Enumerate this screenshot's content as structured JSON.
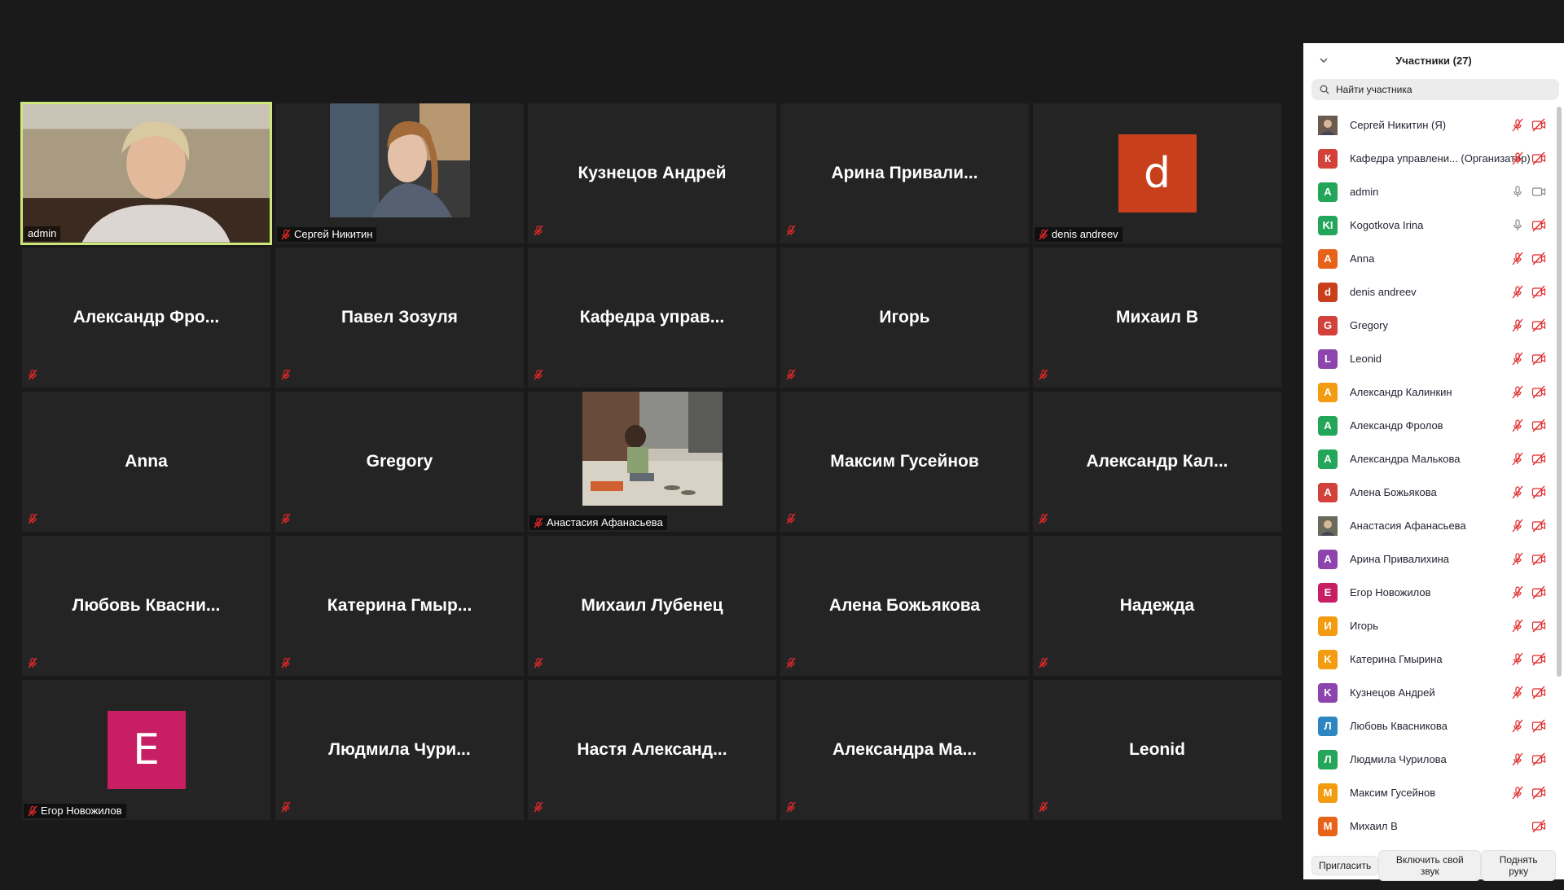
{
  "panel": {
    "title": "Участники (27)",
    "search_placeholder": "Найти участника",
    "footer": {
      "invite": "Пригласить",
      "unmute": "Включить свой звук",
      "raise_hand": "Поднять руку"
    },
    "participants": [
      {
        "name": "Сергей Никитин (Я)",
        "avatar": "",
        "color": "#6b5a4e",
        "photo": true,
        "mic": "muted",
        "video": "off"
      },
      {
        "name": "Кафедра управлени... (Организатор)",
        "avatar": "К",
        "color": "#d2413a",
        "mic": "muted",
        "video": "off"
      },
      {
        "name": "admin",
        "avatar": "A",
        "color": "#23a55a",
        "mic": "on",
        "video": "on"
      },
      {
        "name": "Kogotkova Irina",
        "avatar": "KI",
        "color": "#23a55a",
        "mic": "on",
        "video": "off"
      },
      {
        "name": "Anna",
        "avatar": "A",
        "color": "#e8631a",
        "mic": "muted",
        "video": "off"
      },
      {
        "name": "denis andreev",
        "avatar": "d",
        "color": "#c8401b",
        "mic": "muted",
        "video": "off"
      },
      {
        "name": "Gregory",
        "avatar": "G",
        "color": "#d2413a",
        "mic": "muted",
        "video": "off"
      },
      {
        "name": "Leonid",
        "avatar": "L",
        "color": "#8e44ad",
        "mic": "muted",
        "video": "off"
      },
      {
        "name": "Александр Калинкин",
        "avatar": "A",
        "color": "#f39c12",
        "mic": "muted",
        "video": "off"
      },
      {
        "name": "Александр Фролов",
        "avatar": "A",
        "color": "#23a55a",
        "mic": "muted",
        "video": "off"
      },
      {
        "name": "Александра Малькова",
        "avatar": "A",
        "color": "#23a55a",
        "mic": "muted",
        "video": "off"
      },
      {
        "name": "Алена Божьякова",
        "avatar": "A",
        "color": "#d2413a",
        "mic": "muted",
        "video": "off"
      },
      {
        "name": "Анастасия Афанасьева",
        "avatar": "",
        "color": "#6a6a5a",
        "photo": true,
        "mic": "muted",
        "video": "off"
      },
      {
        "name": "Арина Привалихина",
        "avatar": "A",
        "color": "#8e44ad",
        "mic": "muted",
        "video": "off"
      },
      {
        "name": "Егор Новожилов",
        "avatar": "E",
        "color": "#c81e64",
        "mic": "muted",
        "video": "off"
      },
      {
        "name": "Игорь",
        "avatar": "И",
        "color": "#f39c12",
        "mic": "muted",
        "video": "off"
      },
      {
        "name": "Катерина Гмырина",
        "avatar": "K",
        "color": "#f39c12",
        "mic": "muted",
        "video": "off"
      },
      {
        "name": "Кузнецов Андрей",
        "avatar": "K",
        "color": "#8e44ad",
        "mic": "muted",
        "video": "off"
      },
      {
        "name": "Любовь Квасникова",
        "avatar": "Л",
        "color": "#2e86c1",
        "mic": "muted",
        "video": "off"
      },
      {
        "name": "Людмила Чурилова",
        "avatar": "Л",
        "color": "#23a55a",
        "mic": "muted",
        "video": "off"
      },
      {
        "name": "Максим Гусейнов",
        "avatar": "M",
        "color": "#f39c12",
        "mic": "muted",
        "video": "off"
      },
      {
        "name": "Михаил В",
        "avatar": "M",
        "color": "#e8631a",
        "mic": "none",
        "video": "off"
      }
    ]
  },
  "tiles": [
    {
      "type": "video",
      "label": "admin",
      "active": true,
      "photo": "woman"
    },
    {
      "type": "video",
      "label": "Сергей Никитин",
      "photo": "man"
    },
    {
      "type": "name",
      "name": "Кузнецов Андрей"
    },
    {
      "type": "name",
      "name": "Арина  Привали..."
    },
    {
      "type": "avatar",
      "letter": "d",
      "color": "#c8401b",
      "label": "denis andreev"
    },
    {
      "type": "name",
      "name": "Александр  Фро..."
    },
    {
      "type": "name",
      "name": "Павел Зозуля"
    },
    {
      "type": "name",
      "name": "Кафедра  управ..."
    },
    {
      "type": "name",
      "name": "Игорь"
    },
    {
      "type": "name",
      "name": "Михаил В"
    },
    {
      "type": "name",
      "name": "Anna"
    },
    {
      "type": "name",
      "name": "Gregory"
    },
    {
      "type": "video",
      "label": "Анастасия Афанасьева",
      "photo": "child"
    },
    {
      "type": "name",
      "name": "Максим Гусейнов"
    },
    {
      "type": "name",
      "name": "Александр  Кал..."
    },
    {
      "type": "name",
      "name": "Любовь  Квасни..."
    },
    {
      "type": "name",
      "name": "Катерина  Гмыр..."
    },
    {
      "type": "name",
      "name": "Михаил Лубенец"
    },
    {
      "type": "name",
      "name": "Алена Божьякова"
    },
    {
      "type": "name",
      "name": "Надежда"
    },
    {
      "type": "avatar",
      "letter": "E",
      "color": "#c81e64",
      "label": "Егор Новожилов"
    },
    {
      "type": "name",
      "name": "Людмила  Чури..."
    },
    {
      "type": "name",
      "name": "Настя  Александ..."
    },
    {
      "type": "name",
      "name": "Александра  Ма..."
    },
    {
      "type": "name",
      "name": "Leonid"
    }
  ]
}
